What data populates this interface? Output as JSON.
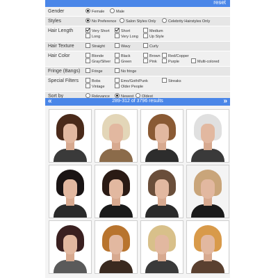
{
  "header": {
    "reset_label": "reset"
  },
  "filters": {
    "gender": {
      "label": "Gender",
      "options": [
        "Female",
        "Male"
      ]
    },
    "styles": {
      "label": "Styles",
      "options": [
        "No Preference",
        "Salon Styles Only",
        "Celebrity Hairstyles Only"
      ]
    },
    "hair_length": {
      "label": "Hair Length",
      "options": [
        "Very Short",
        "Short",
        "Medium",
        "Long",
        "Very Long",
        "Up Style"
      ]
    },
    "hair_texture": {
      "label": "Hair Texture",
      "options": [
        "Straight",
        "Wavy",
        "Curly"
      ]
    },
    "hair_color": {
      "label": "Hair Color",
      "options": [
        "Blonde",
        "Black",
        "Brown",
        "Red/Copper",
        "Gray/Silver",
        "Green",
        "Pink",
        "Purple",
        "Multi-colored"
      ]
    },
    "fringe": {
      "label": "Fringe (Bangs)",
      "options": [
        "Fringe",
        "No fringe"
      ]
    },
    "special": {
      "label": "Special Filters",
      "options": [
        "Bobs",
        "Emo/Goth/Punk",
        "Streaks",
        "Vintage",
        "Older People"
      ]
    },
    "sort": {
      "label": "Sort by",
      "options": [
        "Relevance",
        "Newest",
        "Oldest"
      ]
    }
  },
  "pager": {
    "info": "289-312 of 3796 results",
    "prev": "«",
    "next": "»"
  },
  "gallery": {
    "photos": [
      {
        "hair": "#4a2a1a",
        "bg": "#ffffff",
        "top": "#3a3a3a"
      },
      {
        "hair": "#e3d6b8",
        "bg": "#ffffff",
        "top": "#8b6b4a"
      },
      {
        "hair": "#8a5a34",
        "bg": "#ffffff",
        "top": "#2d2d2d"
      },
      {
        "hair": "#e0e0e0",
        "bg": "#ffffff",
        "top": "#3a3a3a"
      },
      {
        "hair": "#1a1414",
        "bg": "#ffffff",
        "top": "#2a2a2a"
      },
      {
        "hair": "#2a1a14",
        "bg": "#ffffff",
        "top": "#1a1a1a"
      },
      {
        "hair": "#6a4e3a",
        "bg": "#ffffff",
        "top": "#2a2a2a"
      },
      {
        "hair": "#c9a57a",
        "bg": "#f4f4f4",
        "top": "#1a1a1a"
      },
      {
        "hair": "#3a2020",
        "bg": "#ffffff",
        "top": "#5a5a5a"
      },
      {
        "hair": "#b8742e",
        "bg": "#ffffff",
        "top": "#3a2a20"
      },
      {
        "hair": "#d8c08a",
        "bg": "#ffffff",
        "top": "#3a3a3a"
      },
      {
        "hair": "#d89a4a",
        "bg": "#ffffff",
        "top": "#5a4030"
      }
    ]
  }
}
